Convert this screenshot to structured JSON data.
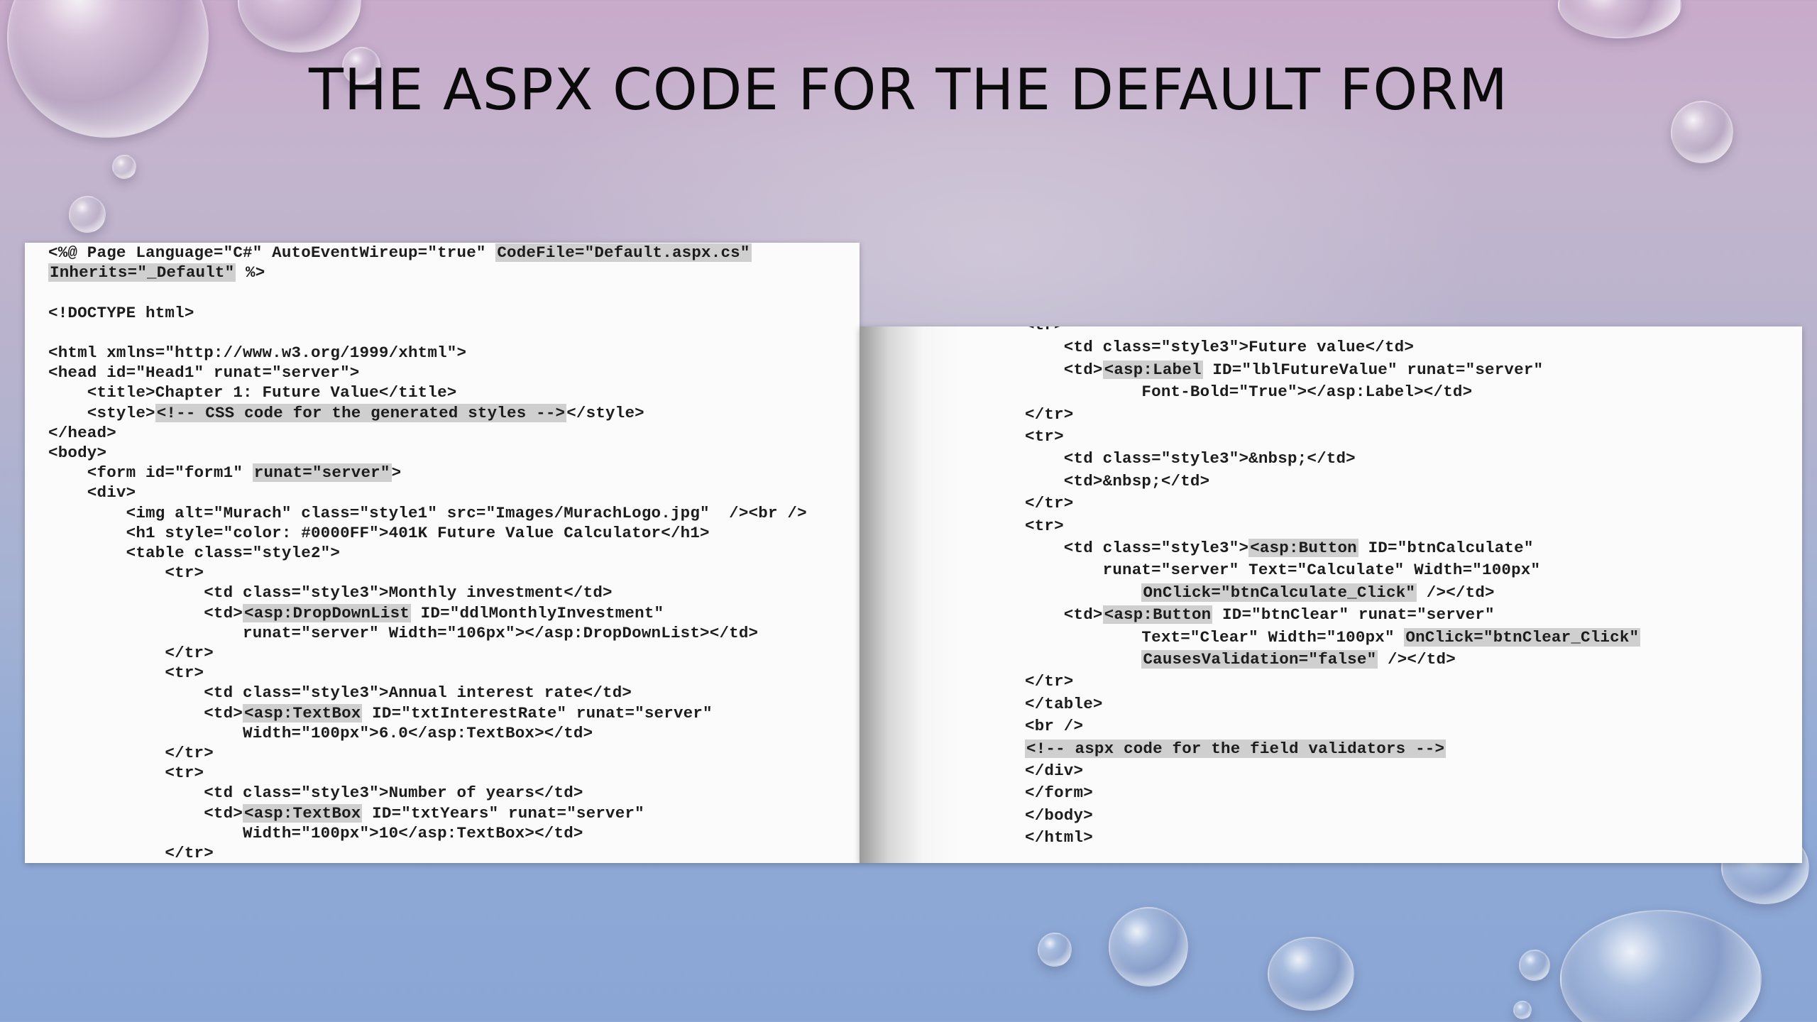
{
  "slide": {
    "title": "THE ASPX CODE FOR THE DEFAULT FORM"
  },
  "left_code": {
    "lines": [
      {
        "segments": [
          {
            "t": "<%@ Page Language=\"C#\" AutoEventWireup=\"true\" "
          },
          {
            "t": "CodeFile=\"Default.aspx.cs\"",
            "hl": true
          }
        ]
      },
      {
        "segments": [
          {
            "t": "Inherits=\"_Default\"",
            "hl": true
          },
          {
            "t": " %>"
          }
        ]
      },
      {
        "segments": [
          {
            "t": ""
          }
        ]
      },
      {
        "segments": [
          {
            "t": "<!DOCTYPE html>"
          }
        ]
      },
      {
        "segments": [
          {
            "t": ""
          }
        ]
      },
      {
        "segments": [
          {
            "t": "<html xmlns=\"http://www.w3.org/1999/xhtml\">"
          }
        ]
      },
      {
        "segments": [
          {
            "t": "<head id=\"Head1\" runat=\"server\">"
          }
        ]
      },
      {
        "segments": [
          {
            "t": "    <title>Chapter 1: Future Value</title>"
          }
        ]
      },
      {
        "segments": [
          {
            "t": "    <style>"
          },
          {
            "t": "<!-- CSS code for the generated styles -->",
            "hl": true
          },
          {
            "t": "</style>"
          }
        ]
      },
      {
        "segments": [
          {
            "t": "</head>"
          }
        ]
      },
      {
        "segments": [
          {
            "t": "<body>"
          }
        ]
      },
      {
        "segments": [
          {
            "t": "    <form id=\"form1\" "
          },
          {
            "t": "runat=\"server\"",
            "hl": true
          },
          {
            "t": ">"
          }
        ]
      },
      {
        "segments": [
          {
            "t": "    <div>"
          }
        ]
      },
      {
        "segments": [
          {
            "t": "        <img alt=\"Murach\" class=\"style1\" src=\"Images/MurachLogo.jpg\"  /><br />"
          }
        ]
      },
      {
        "segments": [
          {
            "t": "        <h1 style=\"color: #0000FF\">401K Future Value Calculator</h1>"
          }
        ]
      },
      {
        "segments": [
          {
            "t": "        <table class=\"style2\">"
          }
        ]
      },
      {
        "segments": [
          {
            "t": "            <tr>"
          }
        ]
      },
      {
        "segments": [
          {
            "t": "                <td class=\"style3\">Monthly investment</td>"
          }
        ]
      },
      {
        "segments": [
          {
            "t": "                <td>"
          },
          {
            "t": "<asp:DropDownList",
            "hl": true
          },
          {
            "t": " ID=\"ddlMonthlyInvestment\""
          }
        ]
      },
      {
        "segments": [
          {
            "t": "                    runat=\"server\" Width=\"106px\"></asp:DropDownList></td>"
          }
        ]
      },
      {
        "segments": [
          {
            "t": "            </tr>"
          }
        ]
      },
      {
        "segments": [
          {
            "t": "            <tr>"
          }
        ]
      },
      {
        "segments": [
          {
            "t": "                <td class=\"style3\">Annual interest rate</td>"
          }
        ]
      },
      {
        "segments": [
          {
            "t": "                <td>"
          },
          {
            "t": "<asp:TextBox",
            "hl": true
          },
          {
            "t": " ID=\"txtInterestRate\" runat=\"server\""
          }
        ]
      },
      {
        "segments": [
          {
            "t": "                    Width=\"100px\">6.0</asp:TextBox></td>"
          }
        ]
      },
      {
        "segments": [
          {
            "t": "            </tr>"
          }
        ]
      },
      {
        "segments": [
          {
            "t": "            <tr>"
          }
        ]
      },
      {
        "segments": [
          {
            "t": "                <td class=\"style3\">Number of years</td>"
          }
        ]
      },
      {
        "segments": [
          {
            "t": "                <td>"
          },
          {
            "t": "<asp:TextBox",
            "hl": true
          },
          {
            "t": " ID=\"txtYears\" runat=\"server\""
          }
        ]
      },
      {
        "segments": [
          {
            "t": "                    Width=\"100px\">10</asp:TextBox></td>"
          }
        ]
      },
      {
        "segments": [
          {
            "t": "            </tr>"
          }
        ]
      }
    ]
  },
  "right_code": {
    "lines": [
      {
        "segments": [
          {
            "t": "<tr>"
          }
        ]
      },
      {
        "segments": [
          {
            "t": "    <td class=\"style3\">Future value</td>"
          }
        ]
      },
      {
        "segments": [
          {
            "t": "    <td>"
          },
          {
            "t": "<asp:Label",
            "hl": true
          },
          {
            "t": " ID=\"lblFutureValue\" runat=\"server\""
          }
        ]
      },
      {
        "segments": [
          {
            "t": "            Font-Bold=\"True\"></asp:Label></td>"
          }
        ]
      },
      {
        "segments": [
          {
            "t": "</tr>"
          }
        ]
      },
      {
        "segments": [
          {
            "t": "<tr>"
          }
        ]
      },
      {
        "segments": [
          {
            "t": "    <td class=\"style3\">&nbsp;</td>"
          }
        ]
      },
      {
        "segments": [
          {
            "t": "    <td>&nbsp;</td>"
          }
        ]
      },
      {
        "segments": [
          {
            "t": "</tr>"
          }
        ]
      },
      {
        "segments": [
          {
            "t": "<tr>"
          }
        ]
      },
      {
        "segments": [
          {
            "t": "    <td class=\"style3\">"
          },
          {
            "t": "<asp:Button",
            "hl": true
          },
          {
            "t": " ID=\"btnCalculate\""
          }
        ]
      },
      {
        "segments": [
          {
            "t": "        runat=\"server\" Text=\"Calculate\" Width=\"100px\""
          }
        ]
      },
      {
        "segments": [
          {
            "t": "            "
          },
          {
            "t": "OnClick=\"btnCalculate_Click\"",
            "hl": true
          },
          {
            "t": " /></td>"
          }
        ]
      },
      {
        "segments": [
          {
            "t": "    <td>"
          },
          {
            "t": "<asp:Button",
            "hl": true
          },
          {
            "t": " ID=\"btnClear\" runat=\"server\""
          }
        ]
      },
      {
        "segments": [
          {
            "t": "            Text=\"Clear\" Width=\"100px\" "
          },
          {
            "t": "OnClick=\"btnClear_Click\"",
            "hl": true
          }
        ]
      },
      {
        "segments": [
          {
            "t": "            "
          },
          {
            "t": "CausesValidation=\"false\"",
            "hl": true
          },
          {
            "t": " /></td>"
          }
        ]
      },
      {
        "segments": [
          {
            "t": "</tr>"
          }
        ]
      },
      {
        "segments": [
          {
            "t": "</table>"
          }
        ]
      },
      {
        "segments": [
          {
            "t": "<br />"
          }
        ]
      },
      {
        "segments": [
          {
            "t": "<!-- aspx code for the field validators -->",
            "hl": true
          }
        ]
      },
      {
        "segments": [
          {
            "t": "</div>"
          }
        ]
      },
      {
        "segments": [
          {
            "t": "</form>"
          }
        ]
      },
      {
        "segments": [
          {
            "t": "</body>"
          }
        ]
      },
      {
        "segments": [
          {
            "t": "</html>"
          }
        ]
      }
    ]
  }
}
